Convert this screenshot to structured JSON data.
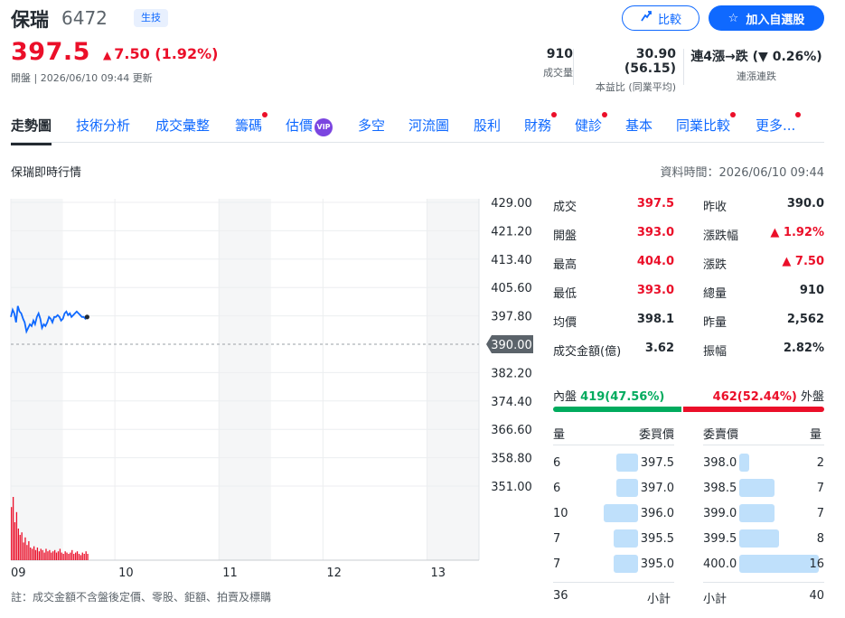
{
  "stock": {
    "name": "保瑞",
    "code": "6472",
    "sector": "生技",
    "price": "397.5",
    "change": "7.50 (1.92%)",
    "change_icon": "up-triangle",
    "meta": "開盤 | 2026/06/10 09:44 更新"
  },
  "actions": {
    "compare_label": "比較",
    "watchlist_label": "加入自選股"
  },
  "stats": [
    {
      "value": "910",
      "label": "成交量"
    },
    {
      "value": "30.90 (56.15)",
      "label": "本益比 (同業平均)"
    },
    {
      "value": "連4漲→跌 (▼ 0.26%)",
      "label": "連漲連跌"
    }
  ],
  "tabs": [
    {
      "label": "走勢圖",
      "active": true,
      "dot": false,
      "vip": false
    },
    {
      "label": "技術分析",
      "active": false,
      "dot": false,
      "vip": false
    },
    {
      "label": "成交彙整",
      "active": false,
      "dot": false,
      "vip": false
    },
    {
      "label": "籌碼",
      "active": false,
      "dot": true,
      "vip": false
    },
    {
      "label": "估價",
      "active": false,
      "dot": false,
      "vip": true
    },
    {
      "label": "多空",
      "active": false,
      "dot": false,
      "vip": false
    },
    {
      "label": "河流圖",
      "active": false,
      "dot": false,
      "vip": false
    },
    {
      "label": "股利",
      "active": false,
      "dot": false,
      "vip": false
    },
    {
      "label": "財務",
      "active": false,
      "dot": true,
      "vip": false
    },
    {
      "label": "健診",
      "active": false,
      "dot": true,
      "vip": false
    },
    {
      "label": "基本",
      "active": false,
      "dot": false,
      "vip": false
    },
    {
      "label": "同業比較",
      "active": false,
      "dot": true,
      "vip": false
    },
    {
      "label": "更多...",
      "active": false,
      "dot": true,
      "vip": false
    }
  ],
  "vip_badge": "VIP",
  "section": {
    "title": "保瑞即時行情",
    "data_time": "資料時間：2026/06/10 09:44"
  },
  "chart_data": {
    "type": "line",
    "y_ticks": [
      "429.00",
      "421.20",
      "413.40",
      "405.60",
      "397.80",
      "390.00",
      "382.20",
      "374.40",
      "366.60",
      "358.80",
      "351.00"
    ],
    "ylim": [
      351.0,
      429.0
    ],
    "reference_price": 390.0,
    "reference_label": "390.00",
    "x_ticks": [
      "09",
      "10",
      "11",
      "12",
      "13"
    ],
    "session_hours": [
      9,
      13.5
    ],
    "line_color": "#0f69ff",
    "volume_color": "#eb0f29",
    "price_series": {
      "t": [
        9.0,
        9.017,
        9.033,
        9.05,
        9.067,
        9.083,
        9.1,
        9.117,
        9.133,
        9.15,
        9.167,
        9.183,
        9.2,
        9.217,
        9.233,
        9.25,
        9.267,
        9.283,
        9.3,
        9.317,
        9.333,
        9.35,
        9.367,
        9.383,
        9.4,
        9.417,
        9.433,
        9.45,
        9.467,
        9.483,
        9.5,
        9.517,
        9.533,
        9.55,
        9.567,
        9.583,
        9.6,
        9.617,
        9.633,
        9.65,
        9.667,
        9.683,
        9.7,
        9.717,
        9.733
      ],
      "v": [
        397.5,
        399.5,
        398.5,
        396.0,
        400.5,
        399.0,
        398.5,
        397.0,
        396.0,
        393.5,
        394.5,
        395.5,
        395.0,
        396.5,
        395.5,
        397.5,
        398.5,
        397.0,
        394.5,
        395.5,
        395.0,
        396.0,
        397.5,
        397.0,
        396.0,
        397.5,
        397.5,
        398.0,
        397.5,
        396.5,
        397.0,
        398.5,
        399.0,
        398.0,
        398.5,
        397.5,
        398.0,
        398.5,
        399.0,
        398.5,
        398.0,
        397.5,
        397.5,
        397.0,
        397.5
      ]
    },
    "volume_series": [
      42,
      50,
      30,
      38,
      25,
      20,
      22,
      14,
      18,
      12,
      15,
      10,
      9,
      11,
      8,
      10,
      7,
      9,
      8,
      6,
      9,
      7,
      8,
      6,
      7,
      8,
      6,
      7,
      9,
      6,
      5,
      7,
      6,
      5,
      6,
      8,
      5,
      6,
      7,
      5,
      4,
      6,
      5,
      7,
      5
    ]
  },
  "quote": {
    "left": [
      {
        "label": "成交",
        "value": "397.5",
        "color": "red"
      },
      {
        "label": "開盤",
        "value": "393.0",
        "color": "red"
      },
      {
        "label": "最高",
        "value": "404.0",
        "color": "red"
      },
      {
        "label": "最低",
        "value": "393.0",
        "color": "red"
      },
      {
        "label": "均價",
        "value": "398.1",
        "color": "dark"
      },
      {
        "label": "成交金額(億)",
        "value": "3.62",
        "color": "dark"
      }
    ],
    "right": [
      {
        "label": "昨收",
        "value": "390.0",
        "color": "dark"
      },
      {
        "label": "漲跌幅",
        "value": "▲ 1.92%",
        "color": "red"
      },
      {
        "label": "漲跌",
        "value": "▲ 7.50",
        "color": "red"
      },
      {
        "label": "總量",
        "value": "910",
        "color": "dark"
      },
      {
        "label": "昨量",
        "value": "2,562",
        "color": "dark"
      },
      {
        "label": "振幅",
        "value": "2.82%",
        "color": "dark"
      }
    ]
  },
  "inner_outer": {
    "inner_label": "內盤",
    "inner_value": "419(47.56%)",
    "outer_value": "462(52.44%)",
    "outer_label": "外盤",
    "inner_ratio": 0.4756
  },
  "order_book": {
    "headers": {
      "bid_qty": "量",
      "bid_price": "委買價",
      "ask_price": "委賣價",
      "ask_qty": "量"
    },
    "rows": [
      {
        "bid_qty": "6",
        "bid_price": "397.5",
        "ask_price": "398.0",
        "ask_qty": "2"
      },
      {
        "bid_qty": "6",
        "bid_price": "397.0",
        "ask_price": "398.5",
        "ask_qty": "7"
      },
      {
        "bid_qty": "10",
        "bid_price": "396.0",
        "ask_price": "399.0",
        "ask_qty": "7"
      },
      {
        "bid_qty": "7",
        "bid_price": "395.5",
        "ask_price": "399.5",
        "ask_qty": "8"
      },
      {
        "bid_qty": "7",
        "bid_price": "395.0",
        "ask_price": "400.0",
        "ask_qty": "16"
      }
    ],
    "subtotal": {
      "bid_qty": "36",
      "bid_label": "小計",
      "ask_label": "小計",
      "ask_qty": "40"
    }
  },
  "note": "註：成交金額不含盤後定價、零股、鉅額、拍賣及標購"
}
